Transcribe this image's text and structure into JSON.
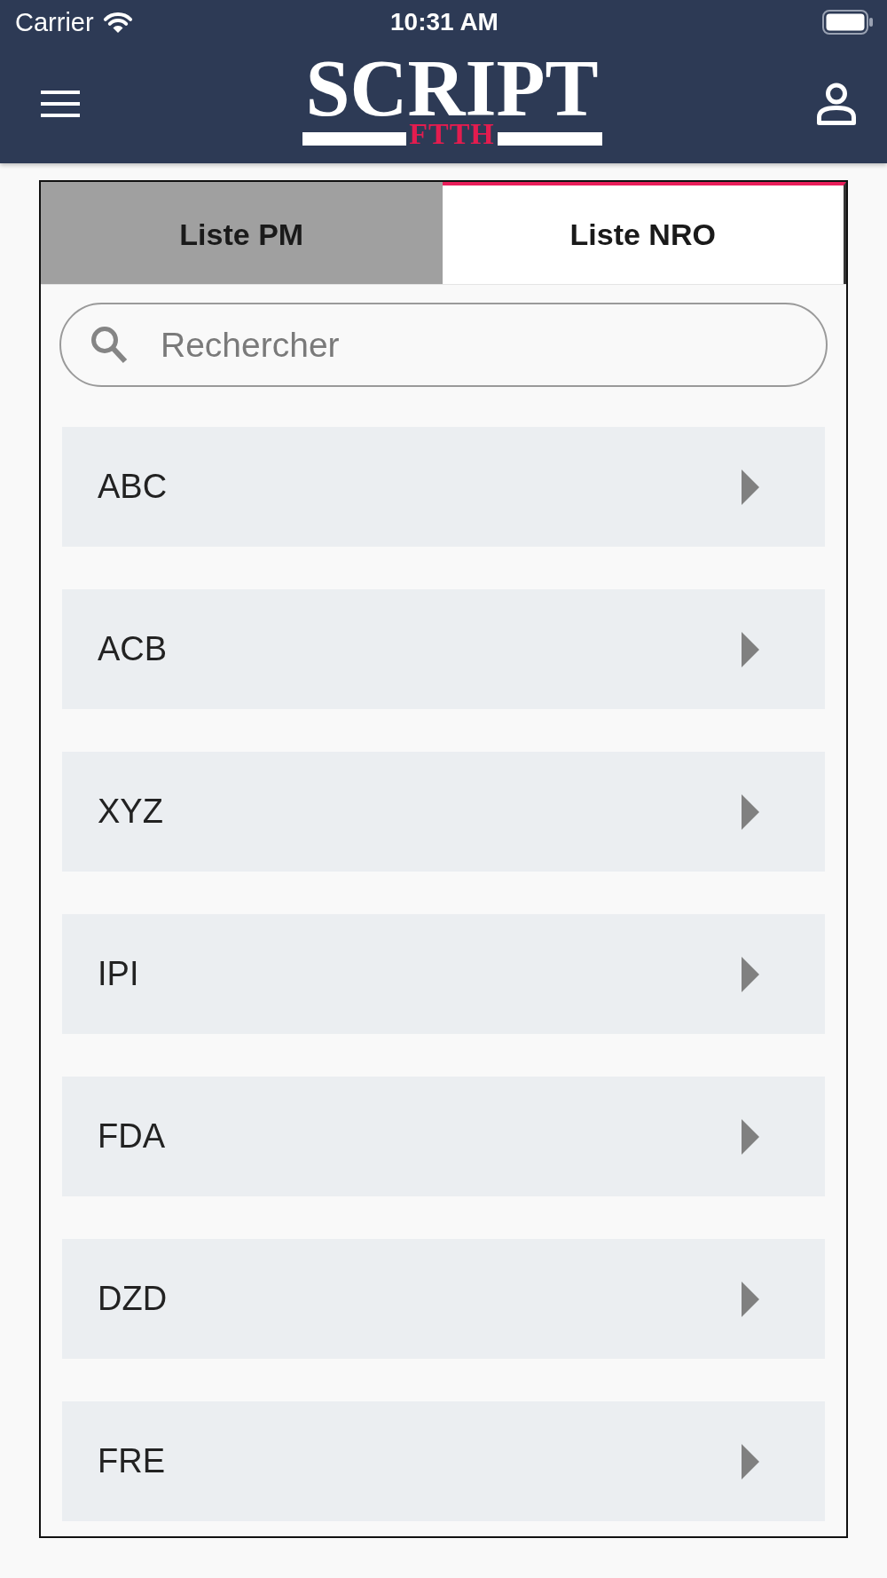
{
  "status_bar": {
    "carrier": "Carrier",
    "time": "10:31 AM"
  },
  "header": {
    "logo": {
      "title": "SCRIPT",
      "subtitle": "FTTH"
    }
  },
  "tabs": [
    {
      "label": "Liste PM",
      "selected": false
    },
    {
      "label": "Liste NRO",
      "selected": true
    }
  ],
  "search": {
    "placeholder": "Rechercher"
  },
  "items": [
    {
      "label": "ABC"
    },
    {
      "label": "ACB"
    },
    {
      "label": "XYZ"
    },
    {
      "label": "IPI"
    },
    {
      "label": "FDA"
    },
    {
      "label": "DZD"
    },
    {
      "label": "FRE"
    }
  ]
}
